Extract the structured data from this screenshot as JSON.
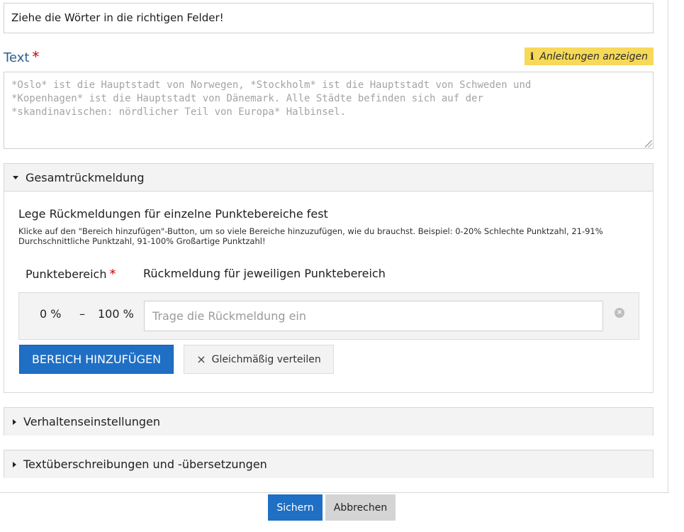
{
  "task": {
    "title_value": "Ziehe die Wörter in die richtigen Felder!"
  },
  "text_field": {
    "label": "Text",
    "required_mark": "*",
    "hint_button": "Anleitungen anzeigen",
    "hint_icon": "info-icon",
    "placeholder": "*Oslo* ist die Hauptstadt von Norwegen, *Stockholm* ist die Hauptstadt von Schweden und\n*Kopenhagen* ist die Hauptstadt von Dänemark. Alle Städte befinden sich auf der\n*skandinavischen: nördlicher Teil von Europa* Halbinsel."
  },
  "overall_feedback": {
    "section_title": "Gesamtrückmeldung",
    "heading": "Lege Rückmeldungen für einzelne Punktebereiche fest",
    "description": "Klicke auf den \"Bereich hinzufügen\"-Button, um so viele Bereiche hinzuzufügen, wie du brauchst. Beispiel: 0-20% Schlechte Punktzahl, 21-91% Durchschnittliche Punktzahl, 91-100% Großartige Punktzahl!",
    "col_range": "Punktebereich",
    "col_range_required": "*",
    "col_feedback": "Rückmeldung für jeweiligen Punktebereich",
    "ranges": [
      {
        "from": "0 %",
        "dash": "–",
        "to": "100 %",
        "feedback_placeholder": "Trage die Rückmeldung ein"
      }
    ],
    "add_button": "BEREICH HINZUFÜGEN",
    "distribute_button": "Gleichmäßig verteilen",
    "distribute_icon": "×",
    "remove_icon": "×"
  },
  "sections": {
    "behaviour": "Verhaltenseinstellungen",
    "overrides": "Textüberschreibungen und -übersetzungen"
  },
  "actions": {
    "save": "Sichern",
    "cancel": "Abbrechen"
  }
}
